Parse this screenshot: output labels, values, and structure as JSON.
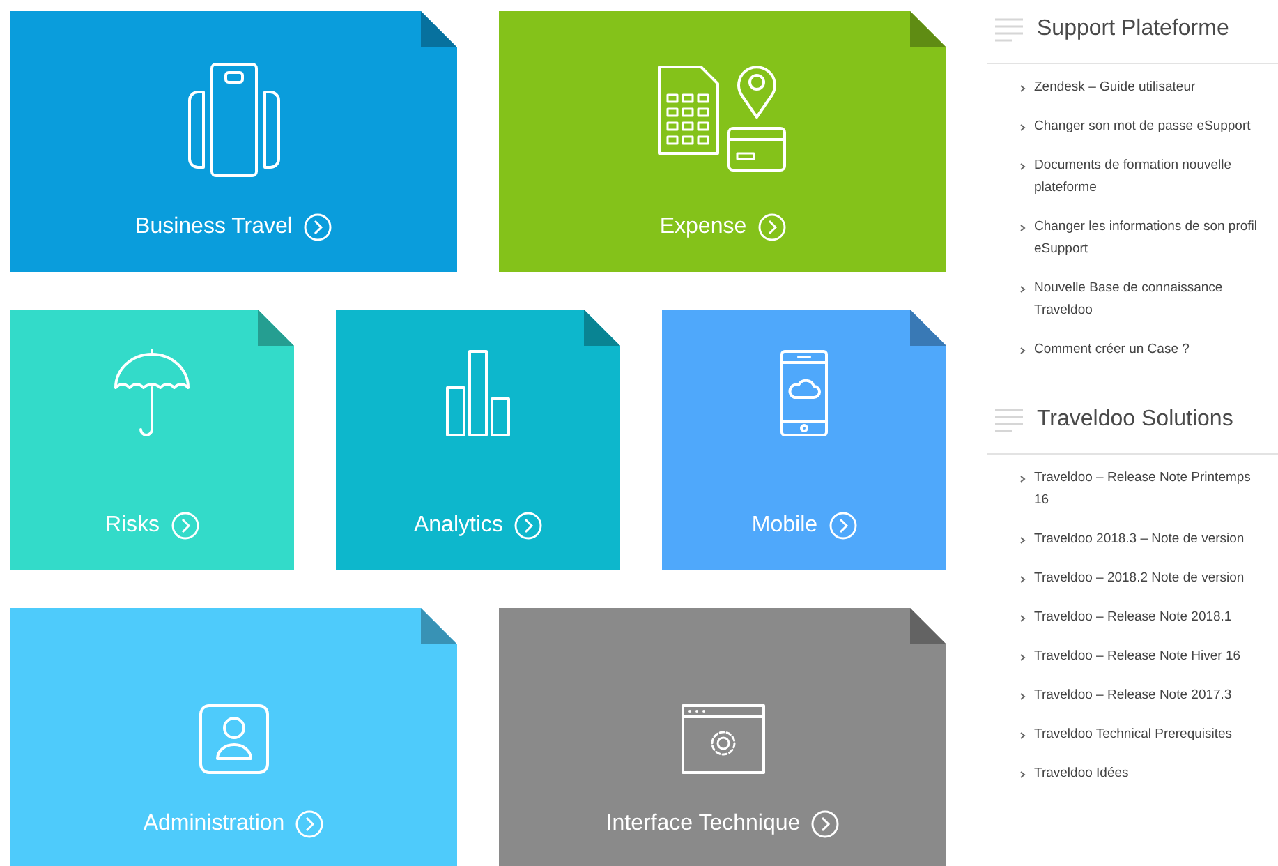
{
  "tiles": [
    {
      "label": "Business Travel",
      "kind": "luggage",
      "color": "#0a9ddc"
    },
    {
      "label": "Expense",
      "kind": "expense",
      "color": "#84c21a"
    },
    {
      "label": "Risks",
      "kind": "umbrella",
      "color": "#33dbc9"
    },
    {
      "label": "Analytics",
      "kind": "chart",
      "color": "#0db7cc"
    },
    {
      "label": "Mobile",
      "kind": "phone",
      "color": "#4fa8fb"
    },
    {
      "label": "Administration",
      "kind": "user",
      "color": "#4ecbfb"
    },
    {
      "label": "Interface Technique",
      "kind": "window",
      "color": "#8a8a8a"
    }
  ],
  "sidebar": [
    {
      "title": "Support Plateforme",
      "links": [
        "Zendesk – Guide utilisateur",
        "Changer son mot de passe eSupport",
        "Documents de formation nouvelle plateforme",
        "Changer les informations de son profil eSupport",
        "Nouvelle Base de connaissance Traveldoo",
        "Comment créer un Case ?"
      ]
    },
    {
      "title": "Traveldoo Solutions",
      "links": [
        "Traveldoo – Release Note Printemps 16",
        "Traveldoo 2018.3 – Note de version",
        "Traveldoo – 2018.2 Note de version",
        "Traveldoo – Release Note 2018.1",
        "Traveldoo – Release Note Hiver 16",
        "Traveldoo – Release Note 2017.3",
        "Traveldoo Technical Prerequisites",
        "Traveldoo Idées"
      ]
    }
  ]
}
